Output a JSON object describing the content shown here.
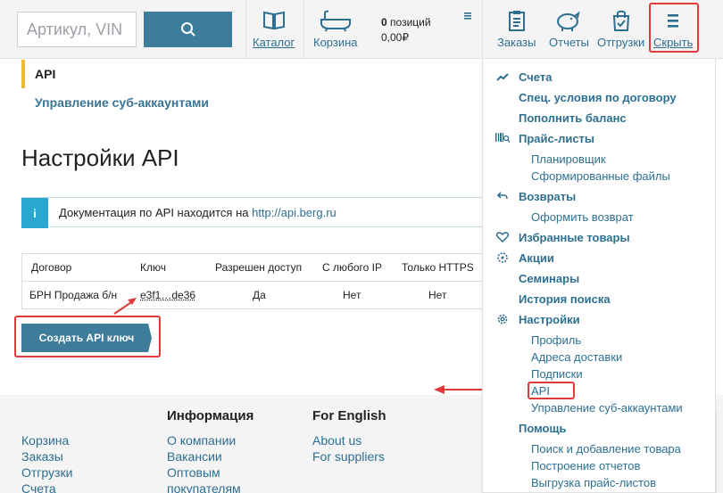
{
  "search": {
    "placeholder": "Артикул, VIN"
  },
  "header": {
    "catalog_label": "Каталог",
    "cart_label": "Корзина",
    "cart_count_num": "0",
    "cart_count_text": "позиций",
    "cart_total": "0,00₽",
    "orders_label": "Заказы",
    "reports_label": "Отчеты",
    "shipments_label": "Отгрузки",
    "hide_label": "Скрыть"
  },
  "breadcrumb": {
    "current": "API",
    "sub": "Управление суб-аккаунтами"
  },
  "page": {
    "title": "Настройки API"
  },
  "info": {
    "icon": "i",
    "text": "Документация по API находится на ",
    "link": "http://api.berg.ru"
  },
  "table": {
    "headers": [
      "Договор",
      "Ключ",
      "Разрешен доступ",
      "С любого IP",
      "Только HTTPS"
    ],
    "rows": [
      [
        "БРН Продажа б/н",
        "e3f1…de36",
        "Да",
        "Нет",
        "Нет"
      ]
    ]
  },
  "create_button": "Создать API ключ",
  "footer": {
    "col1": [
      "Корзина",
      "Заказы",
      "Отгрузки",
      "Счета"
    ],
    "info_head": "Информация",
    "col2": [
      "О компании",
      "Вакансии",
      "Оптовым",
      "покупателям"
    ],
    "english_head": "For English",
    "col3": [
      "About us",
      "For suppliers"
    ]
  },
  "menu": {
    "invoices": "Счета",
    "contract_terms": "Спец. условия по договору",
    "top_up": "Пополнить баланс",
    "price_lists": "Прайс-листы",
    "scheduler": "Планировщик",
    "generated_files": "Сформированные файлы",
    "returns": "Возвраты",
    "make_return": "Оформить возврат",
    "favorites": "Избранные товары",
    "promos": "Акции",
    "seminars": "Семинары",
    "search_history": "История поиска",
    "settings": "Настройки",
    "profile": "Профиль",
    "delivery_addresses": "Адреса доставки",
    "subscriptions": "Подписки",
    "api": "API",
    "subaccounts": "Управление суб-аккаунтами",
    "help": "Помощь",
    "search_add": "Поиск и добавление товара",
    "build_reports": "Построение отчетов",
    "export_price": "Выгрузка прайс-листов"
  },
  "colors": {
    "accent": "#3d7c9a",
    "link": "#2d6f91",
    "highlight": "#e03b3b",
    "breadcrumb": "#f2b83a",
    "info": "#2aa6cf"
  }
}
